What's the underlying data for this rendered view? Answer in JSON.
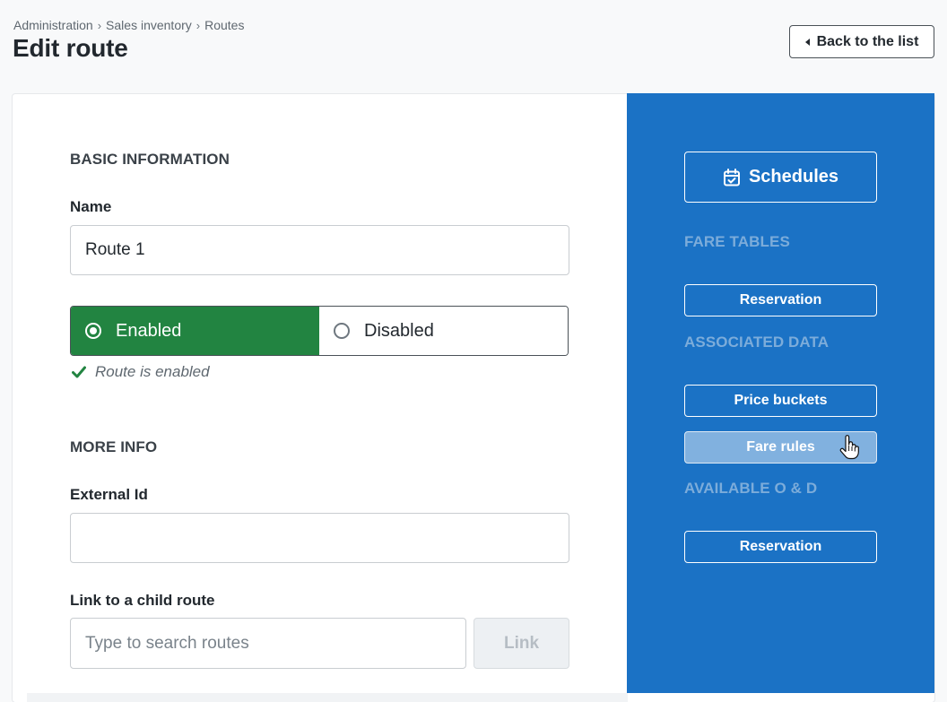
{
  "breadcrumb": [
    "Administration",
    "Sales inventory",
    "Routes"
  ],
  "breadcrumb_separator": "›",
  "page_title": "Edit route",
  "back_button": {
    "label": "Back to the list",
    "icon": "caret-left-icon"
  },
  "basic_info": {
    "section_title": "BASIC INFORMATION",
    "name_label": "Name",
    "name_value": "Route 1",
    "status_toggle": {
      "enabled_label": "Enabled",
      "disabled_label": "Disabled",
      "selected": "Enabled",
      "selected_color": "#228441"
    },
    "status_message": "Route is enabled",
    "status_icon": "checkmark-icon"
  },
  "more_info": {
    "section_title": "MORE INFO",
    "external_id_label": "External Id",
    "external_id_value": "",
    "child_route_label": "Link to a child route",
    "child_route_placeholder": "Type to search routes",
    "link_button": "Link"
  },
  "side_panel": {
    "background": "#1b72c5",
    "schedules_button": {
      "label": "Schedules",
      "icon": "calendar-check-icon"
    },
    "fare_tables": {
      "heading": "FARE TABLES",
      "buttons": [
        "Reservation"
      ]
    },
    "associated_data": {
      "heading": "ASSOCIATED DATA",
      "buttons": [
        "Price buckets",
        "Fare rules"
      ],
      "hovered": "Fare rules"
    },
    "available_od": {
      "heading": "AVAILABLE O & D",
      "buttons": [
        "Reservation"
      ]
    }
  },
  "cursor": "hand-pointer-icon"
}
